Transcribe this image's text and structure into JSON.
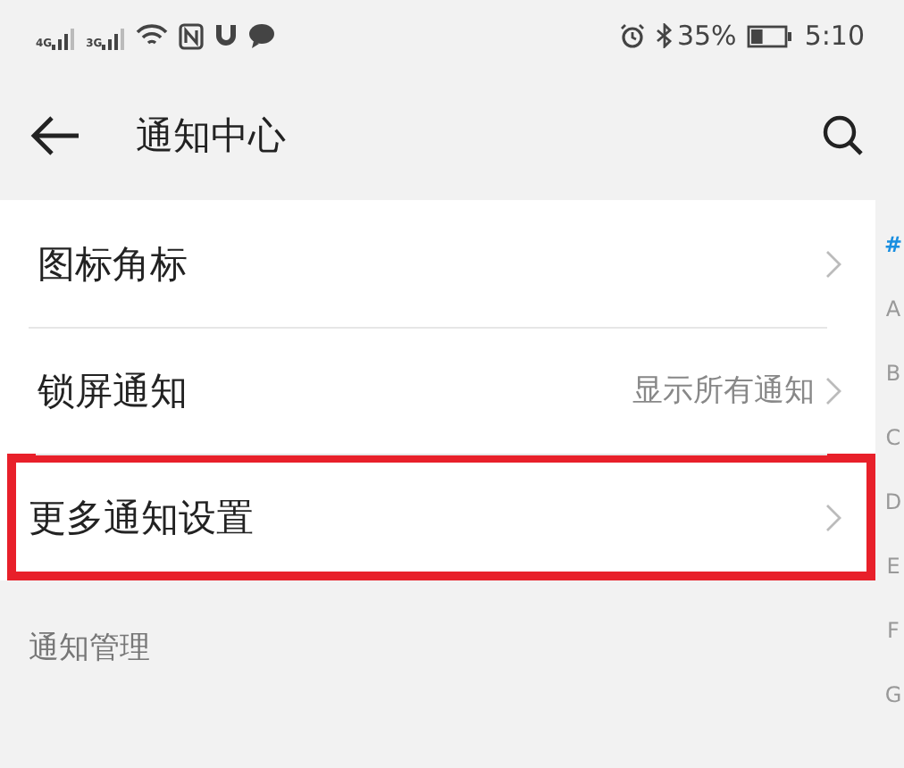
{
  "status_bar": {
    "battery_text": "35%",
    "time": "5:10",
    "network_labels": [
      "4G",
      "3G"
    ]
  },
  "header": {
    "title": "通知中心"
  },
  "settings": [
    {
      "label": "图标角标",
      "highlighted": false
    },
    {
      "label": "锁屏通知",
      "value": "显示所有通知",
      "highlighted": false
    },
    {
      "label": "更多通知设置",
      "highlighted": true
    }
  ],
  "section_header": "通知管理",
  "index_bar": [
    {
      "label": "#",
      "selected": true
    },
    {
      "label": "A",
      "selected": false
    },
    {
      "label": "B",
      "selected": false
    },
    {
      "label": "C",
      "selected": false
    },
    {
      "label": "D",
      "selected": false
    },
    {
      "label": "E",
      "selected": false
    },
    {
      "label": "F",
      "selected": false
    },
    {
      "label": "G",
      "selected": false
    }
  ]
}
